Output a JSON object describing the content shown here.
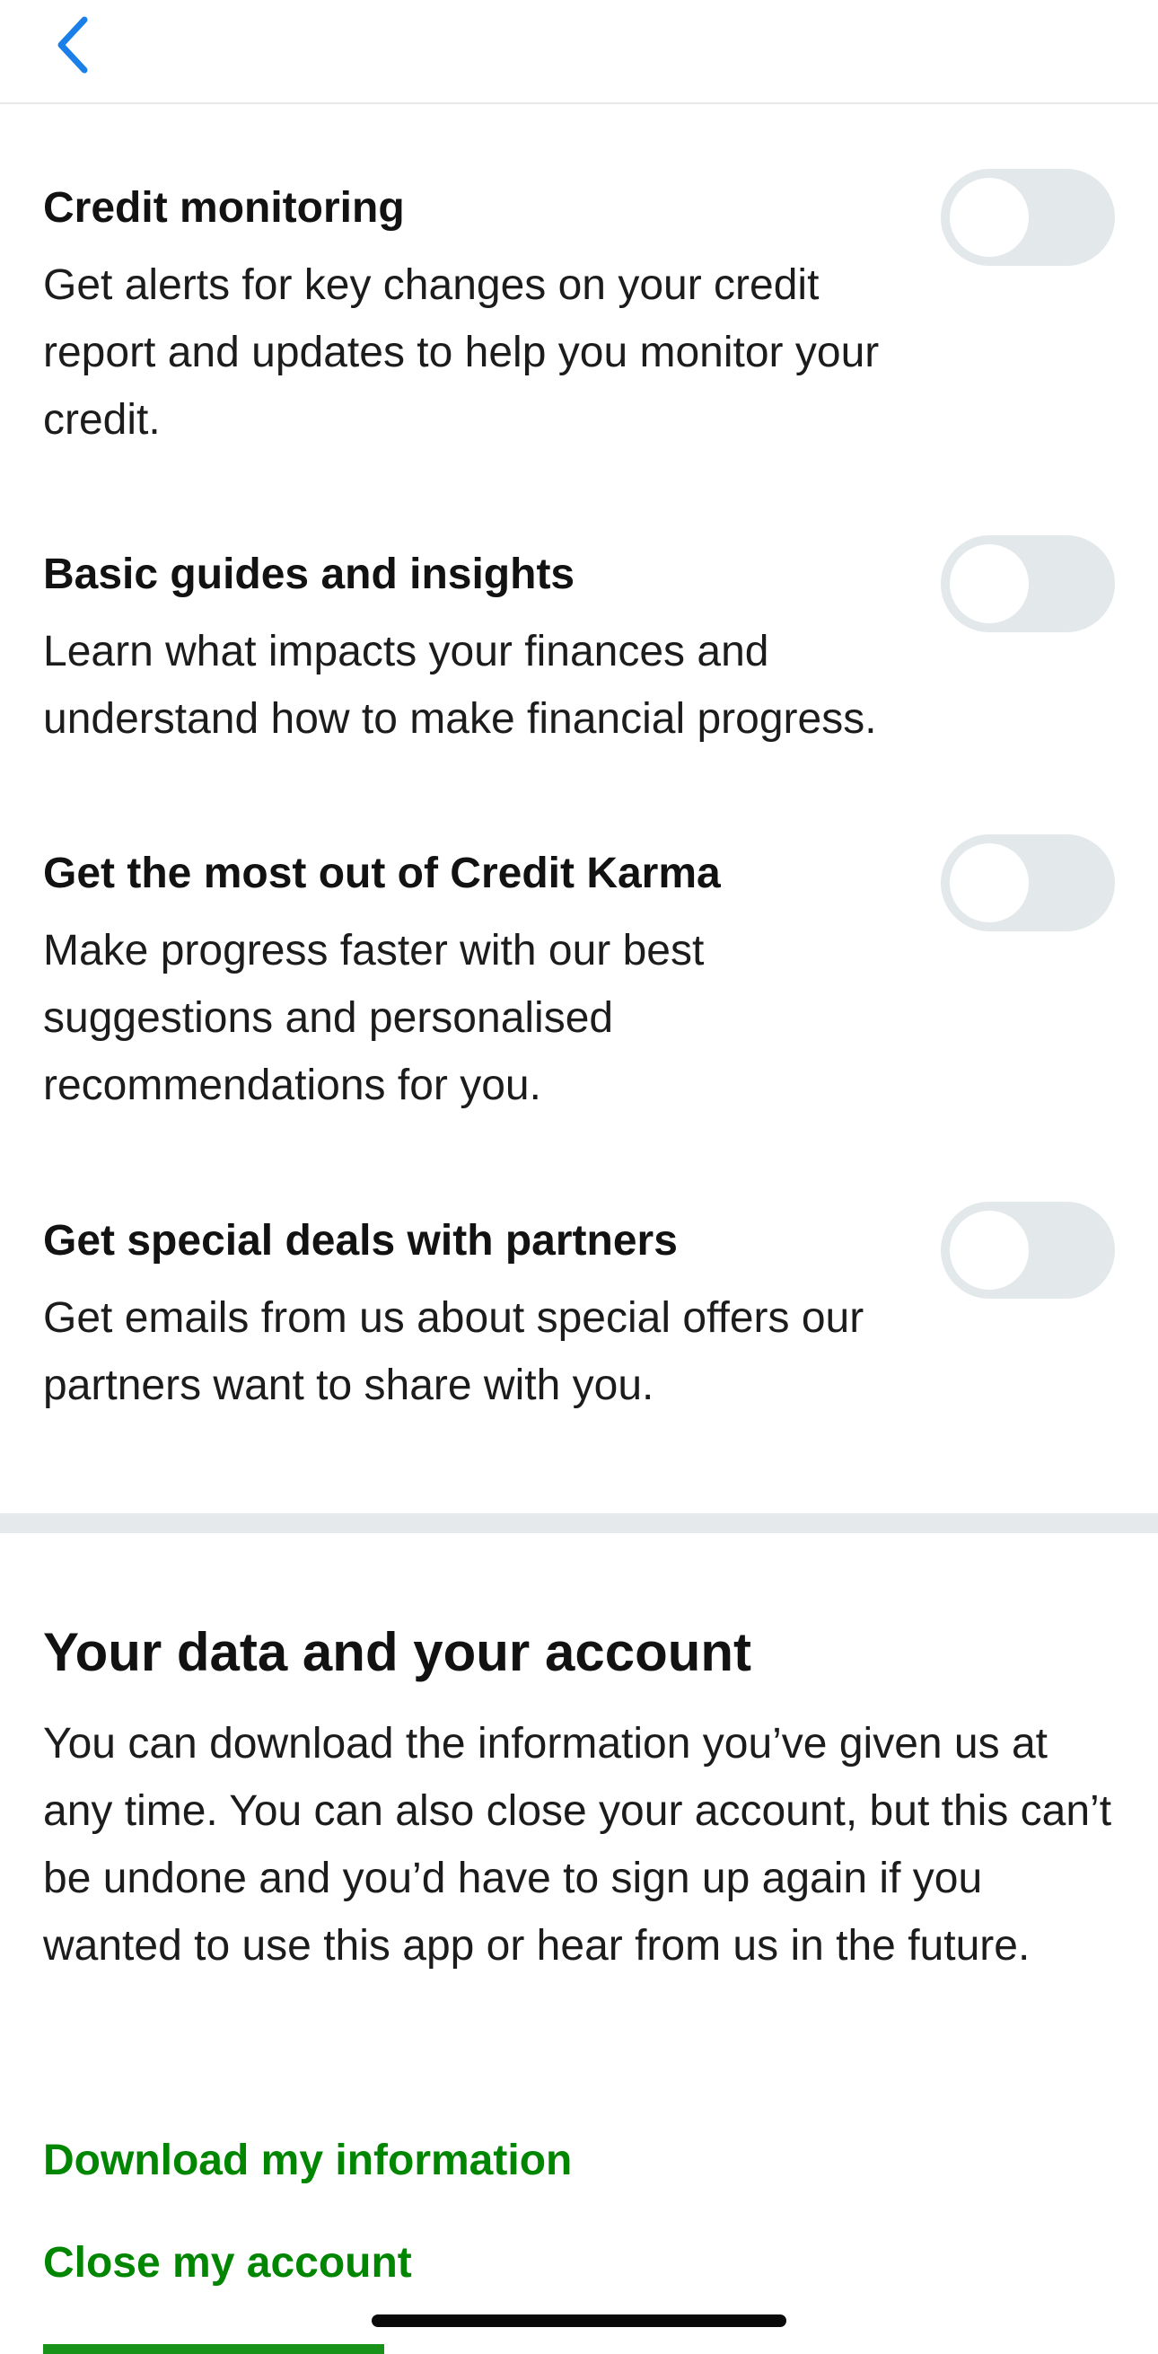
{
  "nav": {
    "back_icon": "chevron-left-icon",
    "accent_color": "#1a7fe8"
  },
  "preferences": [
    {
      "title": "Credit monitoring",
      "description": "Get alerts for key changes on your credit report and updates to help you monitor your credit.",
      "enabled": false
    },
    {
      "title": "Basic guides and insights",
      "description": "Learn what impacts your finances and understand how to make financial progress.",
      "enabled": false
    },
    {
      "title": "Get the most out of Credit Karma",
      "description": "Make progress faster with our best suggestions and personalised recommendations for you.",
      "enabled": false
    },
    {
      "title": "Get special deals with partners",
      "description": "Get emails from us about special offers our partners want to share with you.",
      "enabled": false
    }
  ],
  "data_section": {
    "title": "Your data and your account",
    "body": "You can download the information you’ve given us at any time. You can also close your account, but this can’t be undone and you’d have to sign up again if you wanted to use this app or hear from us in the future.",
    "download_link": "Download my information",
    "close_link": "Close my account"
  },
  "colors": {
    "link_green": "#008600",
    "toggle_off": "#e3e8ea",
    "divider": "#e6e9eb"
  }
}
